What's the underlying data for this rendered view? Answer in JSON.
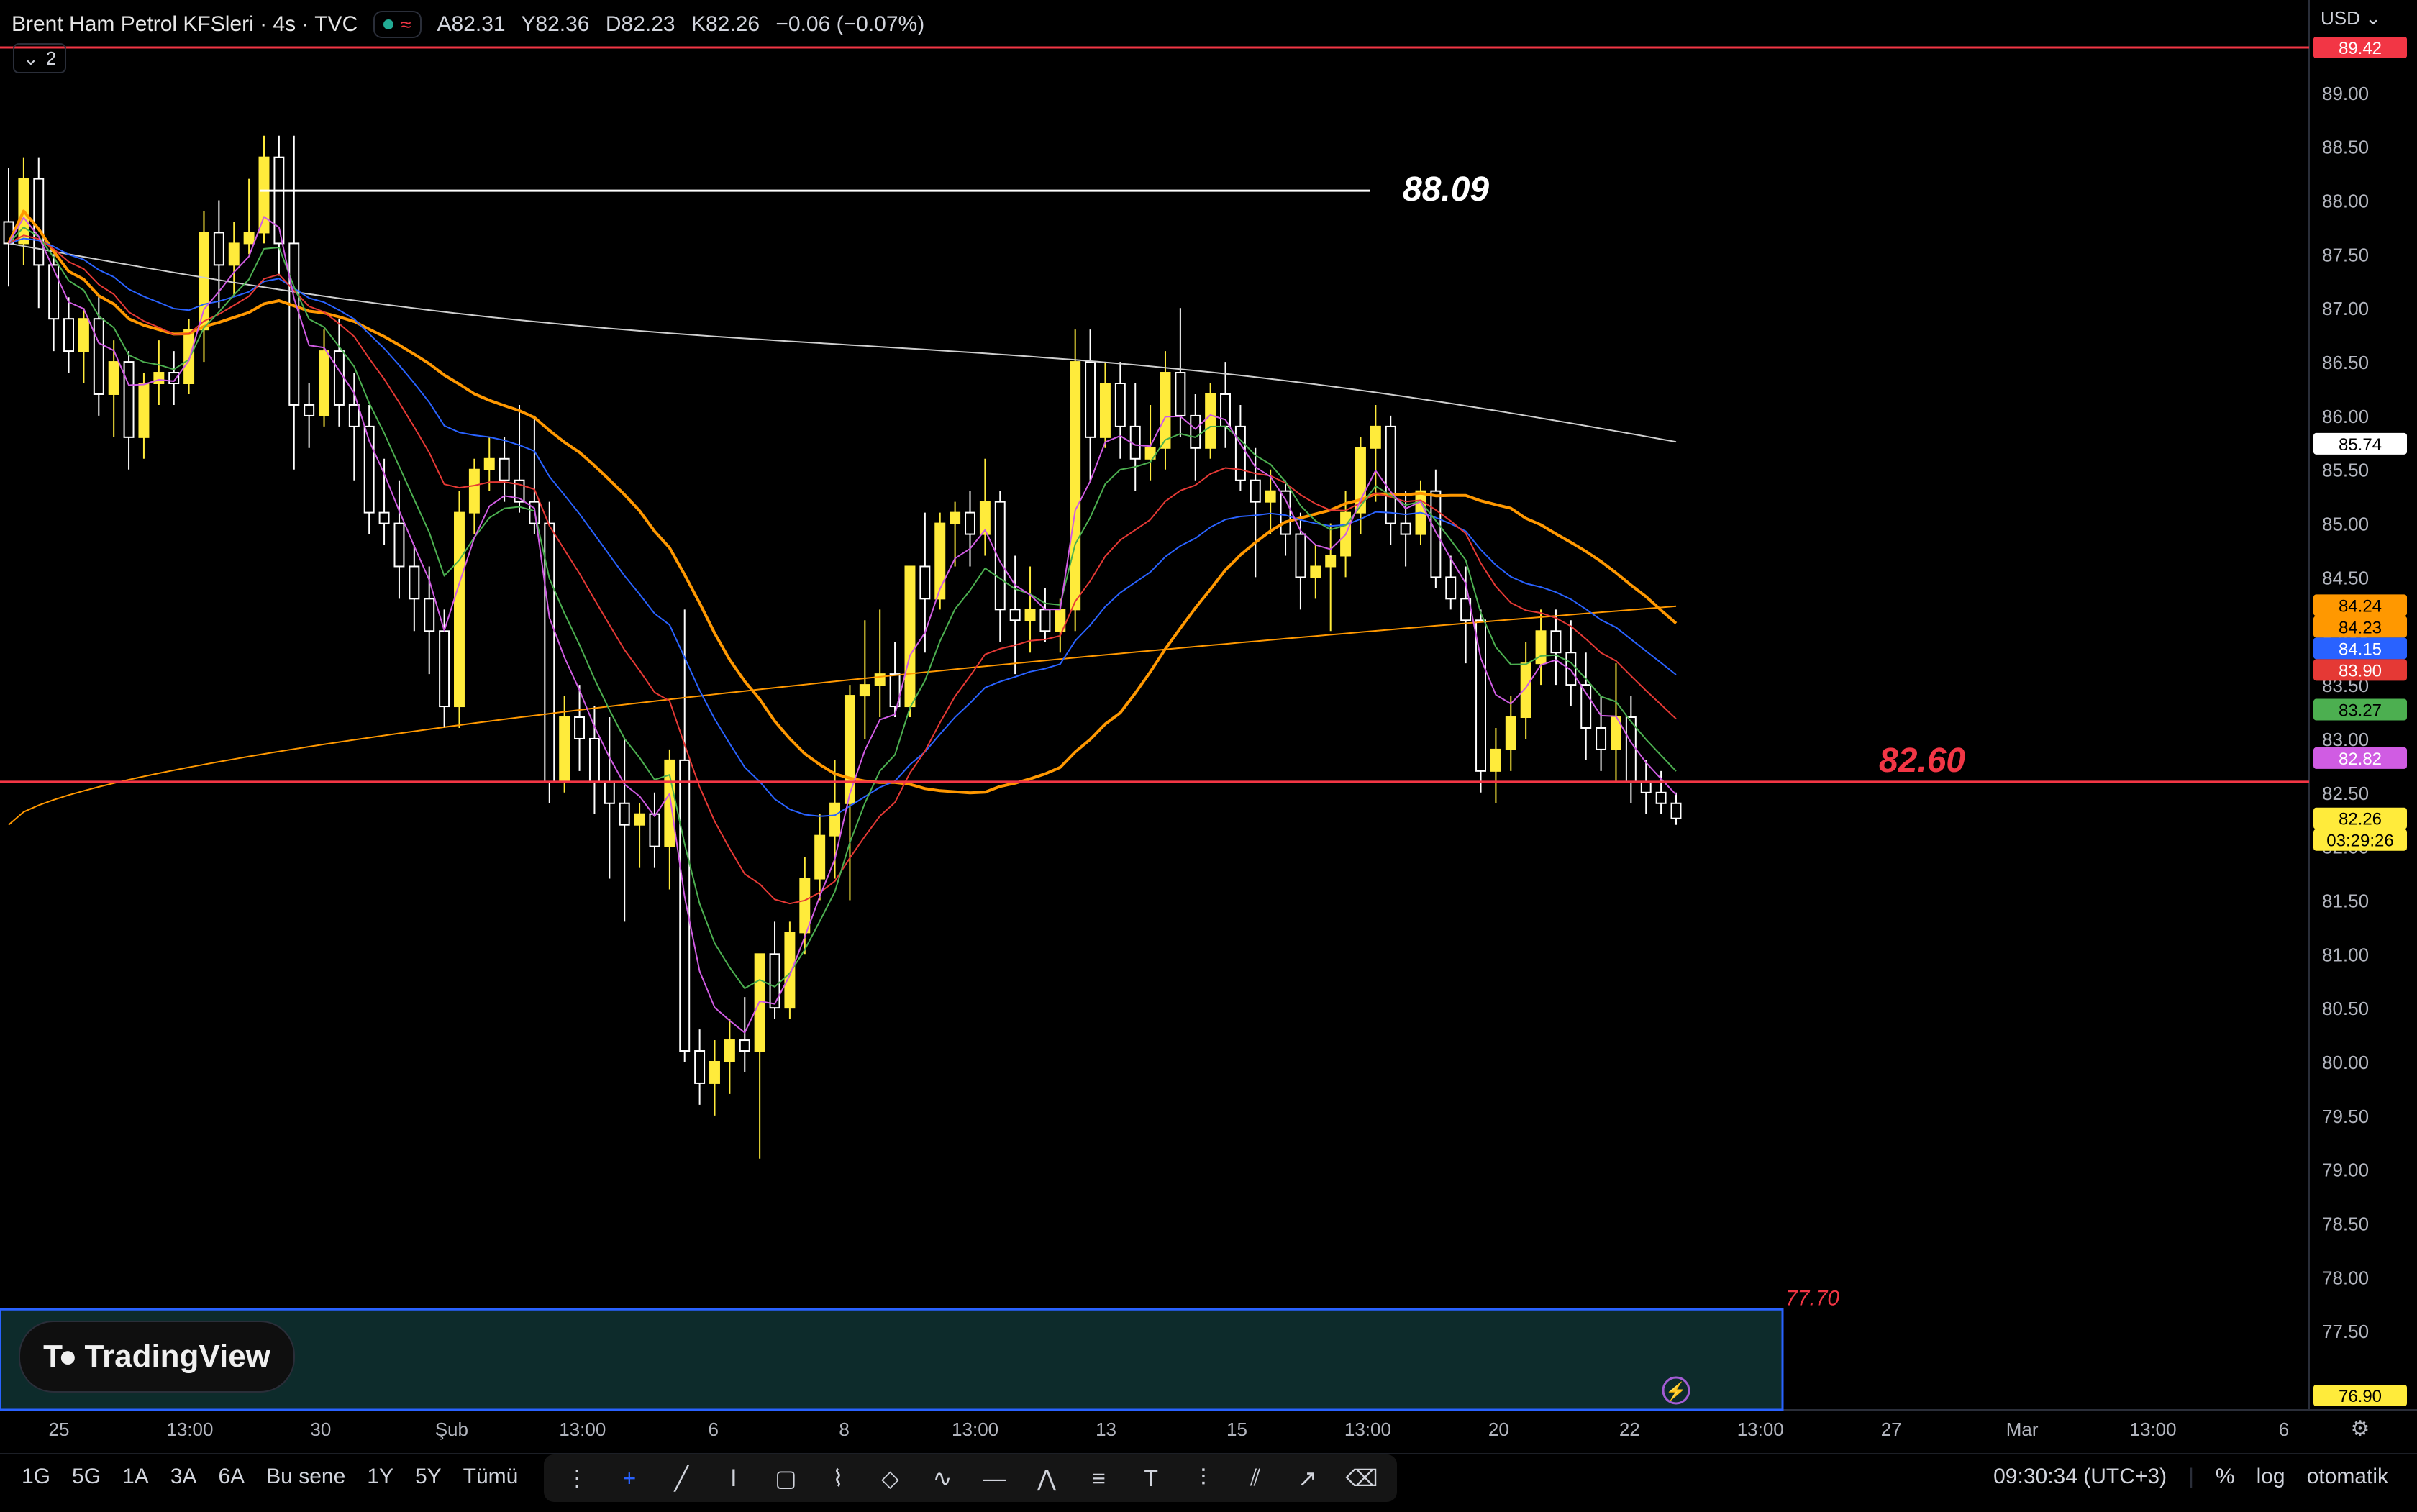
{
  "header": {
    "symbol": "Brent Ham Petrol KFSleri · 4s · TVC",
    "open": "A82.31",
    "high": "Y82.36",
    "low": "D82.23",
    "close": "K82.26",
    "change": "−0.06 (−0.07%)",
    "indicator_count": "2",
    "currency": "USD"
  },
  "logo": {
    "text": "TradingView"
  },
  "footer": {
    "ranges": [
      "1G",
      "5G",
      "1A",
      "3A",
      "6A",
      "Bu sene",
      "1Y",
      "5Y",
      "Tümü"
    ],
    "time": "09:30:34 (UTC+3)",
    "percent": "%",
    "log": "log",
    "auto": "otomatik"
  },
  "tools": [
    "more-icon",
    "crosshair-icon",
    "trendline-icon",
    "text-cursor-icon",
    "rectangle-icon",
    "path-icon",
    "ellipse-icon",
    "brush-icon",
    "horizontal-line-icon",
    "zigzag-icon",
    "fib-icon",
    "text-icon",
    "regression-icon",
    "parallel-channel-icon",
    "ray-icon",
    "eraser-icon"
  ],
  "colors": {
    "bull": "#ffeb3b",
    "bear": "#ffffff",
    "red_line": "#f23645",
    "blue_box": "#2962ff",
    "box_fill": "#0d2b2b",
    "ma_white": "#cfcfcf",
    "ma_orange": "#ff9800",
    "ma_blue": "#2962ff",
    "ma_red": "#e53935",
    "ma_green": "#4caf50",
    "ma_purple": "#d05ce3"
  },
  "chart_data": {
    "type": "candlestick",
    "ylim": [
      76.9,
      89.42
    ],
    "yticks": [
      "89.00",
      "88.50",
      "88.00",
      "87.50",
      "87.00",
      "86.50",
      "86.00",
      "85.50",
      "85.00",
      "84.50",
      "84.00",
      "83.50",
      "83.00",
      "82.50",
      "82.00",
      "81.50",
      "81.00",
      "80.50",
      "80.00",
      "79.50",
      "79.00",
      "78.50",
      "78.00",
      "77.50"
    ],
    "xticks": [
      "25",
      "13:00",
      "30",
      "Şub",
      "13:00",
      "6",
      "8",
      "13:00",
      "13",
      "15",
      "13:00",
      "20",
      "22",
      "13:00",
      "27",
      "Mar",
      "13:00",
      "6"
    ],
    "annotations": {
      "hline_88": {
        "label": "88.09",
        "value": 88.09
      },
      "hline_red": {
        "label": "82.60",
        "value": 82.6
      },
      "box_label": {
        "label": "77.70",
        "value": 77.7
      }
    },
    "price_labels": [
      {
        "text": "89.42",
        "value": 89.42,
        "bg": "#f23645",
        "fg": "#ffffff"
      },
      {
        "text": "85.74",
        "value": 85.74,
        "bg": "#ffffff",
        "fg": "#000000"
      },
      {
        "text": "84.24",
        "value": 84.24,
        "bg": "#ff9800",
        "fg": "#000000"
      },
      {
        "text": "84.23",
        "value": 84.23,
        "bg": "#ff9800",
        "fg": "#000000"
      },
      {
        "text": "84.15",
        "value": 84.15,
        "bg": "#2962ff",
        "fg": "#ffffff"
      },
      {
        "text": "83.90",
        "value": 83.9,
        "bg": "#e53935",
        "fg": "#ffffff"
      },
      {
        "text": "83.27",
        "value": 83.27,
        "bg": "#4caf50",
        "fg": "#000000"
      },
      {
        "text": "82.82",
        "value": 82.82,
        "bg": "#d05ce3",
        "fg": "#ffffff"
      },
      {
        "text": "82.26",
        "value": 82.26,
        "bg": "#ffeb3b",
        "fg": "#000000"
      },
      {
        "text": "03:29:26",
        "value": 82.26,
        "bg": "#ffeb3b",
        "fg": "#000000"
      },
      {
        "text": "76.90",
        "value": 76.9,
        "bg": "#ffeb3b",
        "fg": "#000000"
      }
    ],
    "candles": [
      [
        87.8,
        88.3,
        87.2,
        87.6
      ],
      [
        87.6,
        88.4,
        87.4,
        88.2
      ],
      [
        88.2,
        88.4,
        87.0,
        87.4
      ],
      [
        87.4,
        87.5,
        86.6,
        86.9
      ],
      [
        86.9,
        87.1,
        86.4,
        86.6
      ],
      [
        86.6,
        87.0,
        86.3,
        86.9
      ],
      [
        86.9,
        87.1,
        86.0,
        86.2
      ],
      [
        86.2,
        86.7,
        85.8,
        86.5
      ],
      [
        86.5,
        86.6,
        85.5,
        85.8
      ],
      [
        85.8,
        86.4,
        85.6,
        86.3
      ],
      [
        86.3,
        86.7,
        86.1,
        86.4
      ],
      [
        86.4,
        86.6,
        86.1,
        86.3
      ],
      [
        86.3,
        86.9,
        86.2,
        86.8
      ],
      [
        86.8,
        87.9,
        86.5,
        87.7
      ],
      [
        87.7,
        88.0,
        87.0,
        87.4
      ],
      [
        87.4,
        87.8,
        87.1,
        87.6
      ],
      [
        87.6,
        88.2,
        87.5,
        87.7
      ],
      [
        87.7,
        88.6,
        87.6,
        88.4
      ],
      [
        88.4,
        88.6,
        87.3,
        87.6
      ],
      [
        87.6,
        88.6,
        85.5,
        86.1
      ],
      [
        86.1,
        86.3,
        85.7,
        86.0
      ],
      [
        86.0,
        86.8,
        85.9,
        86.6
      ],
      [
        86.6,
        86.9,
        85.9,
        86.1
      ],
      [
        86.1,
        86.4,
        85.4,
        85.9
      ],
      [
        85.9,
        86.1,
        84.9,
        85.1
      ],
      [
        85.1,
        85.6,
        84.8,
        85.0
      ],
      [
        85.0,
        85.4,
        84.3,
        84.6
      ],
      [
        84.6,
        84.8,
        84.0,
        84.3
      ],
      [
        84.3,
        84.6,
        83.6,
        84.0
      ],
      [
        84.0,
        84.2,
        83.1,
        83.3
      ],
      [
        83.3,
        85.3,
        83.1,
        85.1
      ],
      [
        85.1,
        85.6,
        84.9,
        85.5
      ],
      [
        85.5,
        85.8,
        85.3,
        85.6
      ],
      [
        85.6,
        85.8,
        85.2,
        85.4
      ],
      [
        85.4,
        86.1,
        85.1,
        85.2
      ],
      [
        85.2,
        86.0,
        84.9,
        85.0
      ],
      [
        85.0,
        85.2,
        82.4,
        82.6
      ],
      [
        82.6,
        83.4,
        82.5,
        83.2
      ],
      [
        83.2,
        83.5,
        82.7,
        83.0
      ],
      [
        83.0,
        83.3,
        82.3,
        82.6
      ],
      [
        82.6,
        83.2,
        81.7,
        82.4
      ],
      [
        82.4,
        83.0,
        81.3,
        82.2
      ],
      [
        82.2,
        82.4,
        81.8,
        82.3
      ],
      [
        82.3,
        82.5,
        81.8,
        82.0
      ],
      [
        82.0,
        82.9,
        81.6,
        82.8
      ],
      [
        82.8,
        84.2,
        80.0,
        80.1
      ],
      [
        80.1,
        80.3,
        79.6,
        79.8
      ],
      [
        79.8,
        80.2,
        79.5,
        80.0
      ],
      [
        80.0,
        80.4,
        79.7,
        80.2
      ],
      [
        80.2,
        80.6,
        79.9,
        80.1
      ],
      [
        80.1,
        80.9,
        79.1,
        81.0
      ],
      [
        81.0,
        81.3,
        80.4,
        80.5
      ],
      [
        80.5,
        81.3,
        80.4,
        81.2
      ],
      [
        81.2,
        81.9,
        81.0,
        81.7
      ],
      [
        81.7,
        82.3,
        81.5,
        82.1
      ],
      [
        82.1,
        82.8,
        81.7,
        82.4
      ],
      [
        82.4,
        83.5,
        81.5,
        83.4
      ],
      [
        83.4,
        84.1,
        83.0,
        83.5
      ],
      [
        83.5,
        84.2,
        83.2,
        83.6
      ],
      [
        83.6,
        83.9,
        83.2,
        83.3
      ],
      [
        83.3,
        84.6,
        83.2,
        84.6
      ],
      [
        84.6,
        85.1,
        83.8,
        84.3
      ],
      [
        84.3,
        85.1,
        84.2,
        85.0
      ],
      [
        85.0,
        85.2,
        84.6,
        85.1
      ],
      [
        85.1,
        85.3,
        84.6,
        84.9
      ],
      [
        84.9,
        85.6,
        84.7,
        85.2
      ],
      [
        85.2,
        85.3,
        83.9,
        84.2
      ],
      [
        84.2,
        84.7,
        83.6,
        84.1
      ],
      [
        84.1,
        84.6,
        83.8,
        84.2
      ],
      [
        84.2,
        84.4,
        83.9,
        84.0
      ],
      [
        84.0,
        84.3,
        83.8,
        84.2
      ],
      [
        84.2,
        86.8,
        84.0,
        86.5
      ],
      [
        86.5,
        86.8,
        85.4,
        85.8
      ],
      [
        85.8,
        86.5,
        85.7,
        86.3
      ],
      [
        86.3,
        86.5,
        85.6,
        85.9
      ],
      [
        85.9,
        86.3,
        85.3,
        85.6
      ],
      [
        85.6,
        86.1,
        85.4,
        85.7
      ],
      [
        85.7,
        86.6,
        85.5,
        86.4
      ],
      [
        86.4,
        87.0,
        85.8,
        86.0
      ],
      [
        86.0,
        86.2,
        85.4,
        85.7
      ],
      [
        85.7,
        86.3,
        85.6,
        86.2
      ],
      [
        86.2,
        86.5,
        85.7,
        85.9
      ],
      [
        85.9,
        86.1,
        85.3,
        85.4
      ],
      [
        85.4,
        85.7,
        84.5,
        85.2
      ],
      [
        85.2,
        85.5,
        84.9,
        85.3
      ],
      [
        85.3,
        85.4,
        84.7,
        84.9
      ],
      [
        84.9,
        85.1,
        84.2,
        84.5
      ],
      [
        84.5,
        84.8,
        84.3,
        84.6
      ],
      [
        84.6,
        85.0,
        84.0,
        84.7
      ],
      [
        84.7,
        85.3,
        84.5,
        85.1
      ],
      [
        85.1,
        85.8,
        84.9,
        85.7
      ],
      [
        85.7,
        86.1,
        85.2,
        85.9
      ],
      [
        85.9,
        86.0,
        84.8,
        85.0
      ],
      [
        85.0,
        85.3,
        84.6,
        84.9
      ],
      [
        84.9,
        85.4,
        84.8,
        85.3
      ],
      [
        85.3,
        85.5,
        84.4,
        84.5
      ],
      [
        84.5,
        84.7,
        84.2,
        84.3
      ],
      [
        84.3,
        84.6,
        83.7,
        84.1
      ],
      [
        84.1,
        84.2,
        82.5,
        82.7
      ],
      [
        82.7,
        83.1,
        82.4,
        82.9
      ],
      [
        82.9,
        83.4,
        82.7,
        83.2
      ],
      [
        83.2,
        83.9,
        83.0,
        83.7
      ],
      [
        83.7,
        84.2,
        83.5,
        84.0
      ],
      [
        84.0,
        84.2,
        83.5,
        83.8
      ],
      [
        83.8,
        84.1,
        83.3,
        83.5
      ],
      [
        83.5,
        83.8,
        82.8,
        83.1
      ],
      [
        83.1,
        83.4,
        82.7,
        82.9
      ],
      [
        82.9,
        83.7,
        82.6,
        83.2
      ],
      [
        83.2,
        83.4,
        82.4,
        82.6
      ],
      [
        82.6,
        82.8,
        82.3,
        82.5
      ],
      [
        82.5,
        82.7,
        82.3,
        82.4
      ],
      [
        82.4,
        82.5,
        82.2,
        82.26
      ]
    ]
  }
}
